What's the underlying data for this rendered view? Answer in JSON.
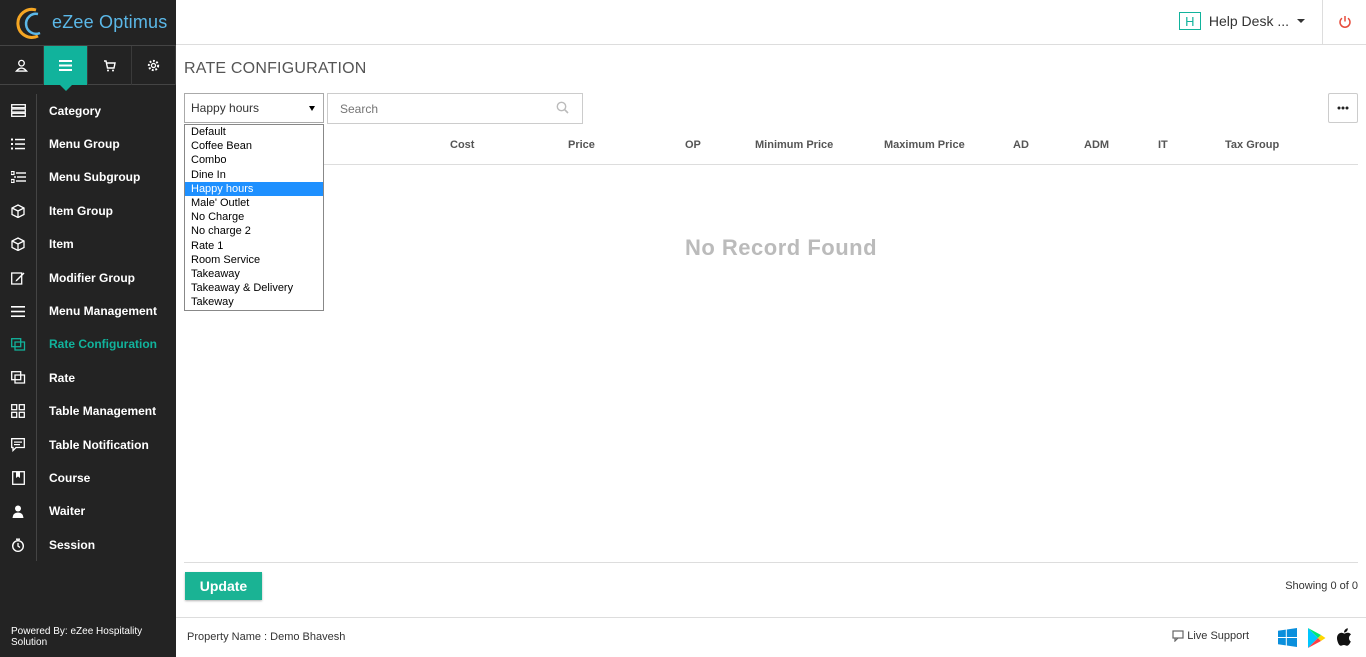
{
  "app": {
    "name": "eZee Optimus"
  },
  "header": {
    "help_badge": "H",
    "help_label": "Help Desk ..."
  },
  "sidebar": {
    "items": [
      {
        "label": "Category",
        "icon": "category-icon"
      },
      {
        "label": "Menu Group",
        "icon": "list-icon"
      },
      {
        "label": "Menu Subgroup",
        "icon": "sublist-icon"
      },
      {
        "label": "Item Group",
        "icon": "box-icon"
      },
      {
        "label": "Item",
        "icon": "box-icon"
      },
      {
        "label": "Modifier Group",
        "icon": "edit-icon"
      },
      {
        "label": "Menu Management",
        "icon": "hamburger-icon"
      },
      {
        "label": "Rate Configuration",
        "icon": "rate-config-icon",
        "active": true
      },
      {
        "label": "Rate",
        "icon": "rate-icon"
      },
      {
        "label": "Table Management",
        "icon": "grid-icon"
      },
      {
        "label": "Table Notification",
        "icon": "chat-icon"
      },
      {
        "label": "Course",
        "icon": "bookmark-icon"
      },
      {
        "label": "Waiter",
        "icon": "person-icon"
      },
      {
        "label": "Session",
        "icon": "timer-icon"
      }
    ],
    "powered_by": "Powered By: eZee Hospitality Solution"
  },
  "main": {
    "title": "RATE CONFIGURATION",
    "rate_selected": "Happy hours",
    "search_placeholder": "Search",
    "columns": [
      "Cost",
      "Price",
      "OP",
      "Minimum Price",
      "Maximum Price",
      "AD",
      "ADM",
      "IT",
      "Tax Group"
    ],
    "empty_text": "No Record Found",
    "update_label": "Update",
    "showing_text": "Showing 0 of 0"
  },
  "dropdown": {
    "options": [
      "Default",
      "Coffee Bean",
      "Combo",
      "Dine In",
      "Happy hours",
      "Male' Outlet",
      "No Charge",
      "No charge 2",
      "Rate 1",
      "Room Service",
      "Takeaway",
      "Takeaway & Delivery",
      "Takeway"
    ],
    "selected_index": 4
  },
  "footer": {
    "property": "Property Name : Demo Bhavesh",
    "live_support": "Live Support"
  },
  "colors": {
    "accent": "#11b39c",
    "sidebar_bg": "#232323",
    "selected_option": "#1e90ff",
    "power": "#e74c3c"
  }
}
